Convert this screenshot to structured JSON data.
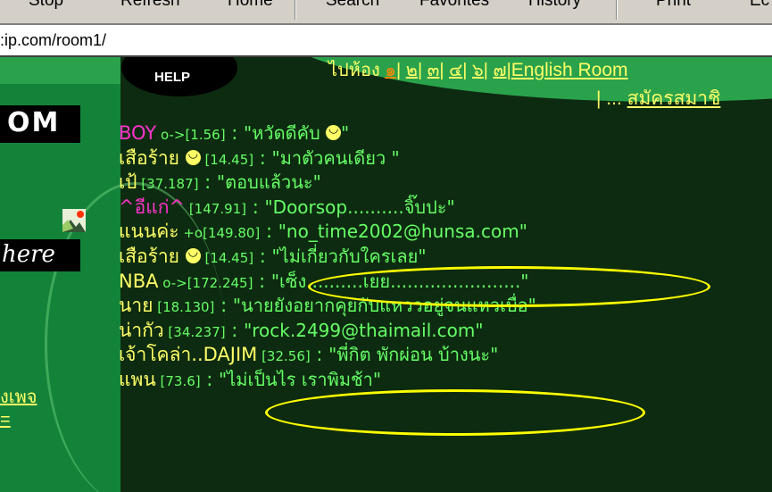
{
  "toolbar": {
    "stop": "Stop",
    "refresh": "Refresh",
    "home": "Home",
    "search": "Search",
    "favorites": "Favorites",
    "history": "History",
    "print": "Print",
    "edit": "Ec"
  },
  "address": {
    "url": ":ip.com/room1/"
  },
  "sidebar": {
    "logo": "OM",
    "here": "here",
    "link1": "งเพจ",
    "link2": "="
  },
  "help": {
    "label": "HELP"
  },
  "nav": {
    "goto_room": "ไปห้อง",
    "rooms": [
      "๑",
      "๒",
      "๓",
      "๔",
      "๖",
      "๗"
    ],
    "english_room": "English Room",
    "dots": "| ... ",
    "register": "สมัครสมาชิ"
  },
  "messages": [
    {
      "nick": "BOY",
      "nick_color": "#ff33cc",
      "ip": " o->[1.56]",
      "text": "\"หวัดดีคับ ",
      "smiley_after_text": true,
      "text_end": "\""
    },
    {
      "nick": "เสือร้าย",
      "nick_color": "#ffff66",
      "smiley_after_nick": true,
      "ip": " [14.45]",
      "text": "\"มาตัวคนเดียว \""
    },
    {
      "nick": "เป้",
      "nick_color": "#ffff66",
      "ip": " [37.187]",
      "text": "\"ตอบแล้วนะ\""
    },
    {
      "nick": "^อีแก่^",
      "nick_color": "#ff33cc",
      "ip": " [147.91]",
      "text": "\"Doorsop..........จิ๊บปะ\""
    },
    {
      "nick": "แนนค่ะ",
      "nick_color": "#ffff66",
      "ip": " +o[149.80]",
      "text": "\"no_time2002@hunsa.com\""
    },
    {
      "nick": "เสือร้าย",
      "nick_color": "#ffff66",
      "smiley_after_nick": true,
      "ip": " [14.45]",
      "text": "\"ไม่เกี่ยวกับใครเลย\""
    },
    {
      "nick": "NBA",
      "nick_color": "#ffff66",
      "ip": " o->[172.245]",
      "text": "\"เซ็ง..........เยย.......................\""
    },
    {
      "nick": "นาย",
      "nick_color": "#ffff66",
      "ip": " [18.130]",
      "text": "\"นายยังอยากคุยกับแหววอยู่จนแหวเบื่อ\""
    },
    {
      "nick": "น่ากัว",
      "nick_color": "#ffff66",
      "ip": " [34.237]",
      "text": "\"rock.2499@thaimail.com\""
    },
    {
      "nick": "เจ้าโคล่า..DAJIM",
      "nick_color": "#ffff66",
      "ip": " [32.56]",
      "text": "\"พี่กิต พักผ่อน บ้างนะ\""
    },
    {
      "nick": "แพน",
      "nick_color": "#ffff66",
      "ip": " [73.6]",
      "text": "\"ไม่เป็นไร เราพิมช้า\""
    }
  ],
  "colors": {
    "highlight_oval": "#ffff00",
    "chat_bg": "#0d2b10",
    "text_green": "#66ff66"
  }
}
